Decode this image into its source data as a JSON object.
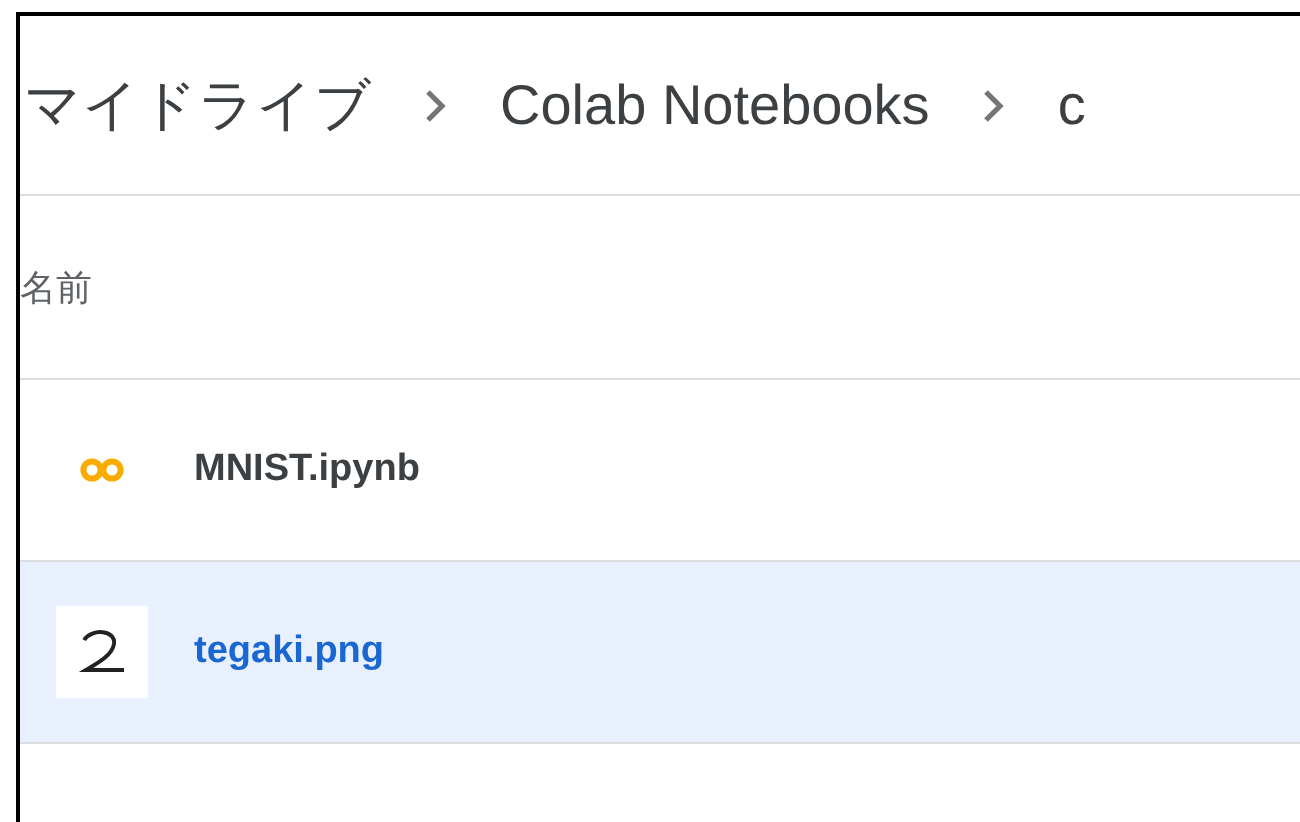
{
  "breadcrumb": [
    {
      "label": "マイドライブ"
    },
    {
      "label": "Colab Notebooks"
    },
    {
      "label": "c"
    }
  ],
  "table": {
    "columns": [
      "名前"
    ],
    "rows": [
      {
        "kind": "notebook",
        "name": "MNIST.ipynb",
        "selected": false
      },
      {
        "kind": "image",
        "name": "tegaki.png",
        "selected": true
      }
    ]
  }
}
